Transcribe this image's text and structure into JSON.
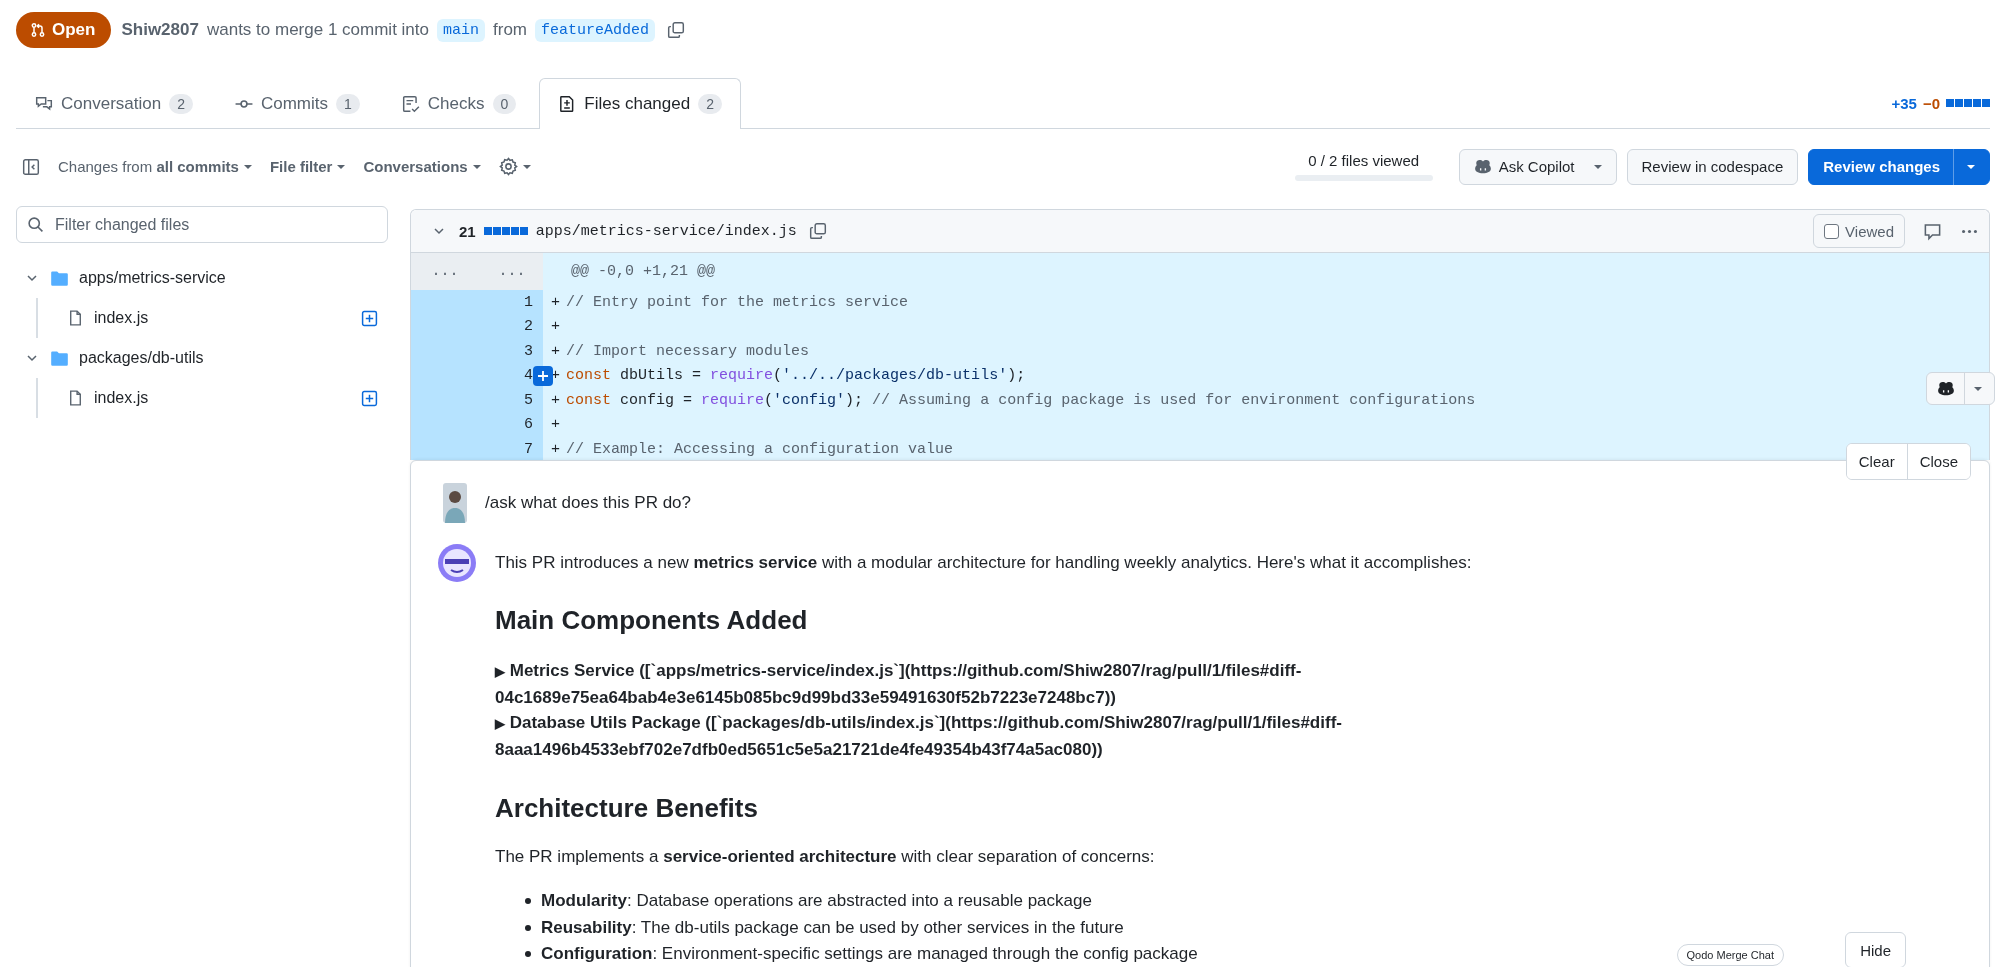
{
  "pr_header": {
    "state": "Open",
    "author": "Shiw2807",
    "text": "wants to merge 1 commit into",
    "base": "main",
    "from_word": "from",
    "head": "featureAdded"
  },
  "tabs": [
    {
      "label": "Conversation",
      "count": "2",
      "selected": false
    },
    {
      "label": "Commits",
      "count": "1",
      "selected": false
    },
    {
      "label": "Checks",
      "count": "0",
      "selected": false
    },
    {
      "label": "Files changed",
      "count": "2",
      "selected": true
    }
  ],
  "diffstat": {
    "additions": "+35",
    "deletions": "−0"
  },
  "toolbar": {
    "changes_from": "Changes from **all commits**",
    "file_filter": "File filter",
    "conversations": "Conversations",
    "files_viewed": {
      "text": "0 / 2 files viewed",
      "level": 0
    },
    "ask_copilot": "Ask Copilot",
    "codespace": "Review in codespace",
    "review": "Review changes"
  },
  "sidebar": {
    "filter_placeholder": "Filter changed files",
    "tree": [
      {
        "name": "apps/metrics-service",
        "expanded": true,
        "children": [
          {
            "name": "index.js"
          }
        ]
      },
      {
        "name": "packages/db-utils",
        "expanded": true,
        "children": [
          {
            "name": "index.js"
          }
        ]
      }
    ]
  },
  "file": {
    "count": "21",
    "path": "apps/metrics-service/index.js",
    "expanded": true,
    "viewed": false,
    "viewed_label": "Viewed",
    "old_marker": "...",
    "new_marker": "...",
    "hunk": "@@ -0,0 +1,21 @@",
    "lines": [
      {
        "number": "1",
        "sign": "+",
        "hovered": false,
        "tokens": [
          {
            "t": "// Entry point for the metrics service",
            "kind": "comment"
          }
        ]
      },
      {
        "number": "2",
        "sign": "+",
        "hovered": false
      },
      {
        "number": "3",
        "sign": "+",
        "hovered": false,
        "tokens": [
          {
            "t": "// Import necessary modules",
            "kind": "comment"
          }
        ]
      },
      {
        "number": "4",
        "sign": "+",
        "hovered": true,
        "tokens": [
          {
            "t": "const",
            "kind": "keyword"
          },
          {
            "t": " dbUtils = ",
            "kind": "plain"
          },
          {
            "t": "require",
            "kind": "function"
          },
          {
            "t": "(",
            "kind": "plain"
          },
          {
            "t": "'../../packages/db-utils'",
            "kind": "string"
          },
          {
            "t": ");",
            "kind": "plain"
          }
        ]
      },
      {
        "number": "5",
        "sign": "+",
        "hovered": false,
        "tokens": [
          {
            "t": "const",
            "kind": "keyword"
          },
          {
            "t": " config = ",
            "kind": "plain"
          },
          {
            "t": "require",
            "kind": "function"
          },
          {
            "t": "(",
            "kind": "plain"
          },
          {
            "t": "'config'",
            "kind": "string"
          },
          {
            "t": "); ",
            "kind": "plain"
          },
          {
            "t": "// Assuming a config package is used for environment configurations",
            "kind": "comment"
          }
        ]
      },
      {
        "number": "6",
        "sign": "+",
        "hovered": false
      },
      {
        "number": "7",
        "sign": "+",
        "hovered": false,
        "tokens": [
          {
            "t": "// Example: Accessing a configuration value",
            "kind": "comment"
          }
        ]
      }
    ]
  },
  "chat": {
    "clear": "Clear",
    "close": "Close",
    "tab_label": "Qodo Merge Chat",
    "hide": "Hide",
    "messages": [
      {
        "kind": "user",
        "text": "/ask what does this PR do?"
      },
      {
        "kind": "bot",
        "blocks": [
          {
            "kind": "paragraph",
            "text": "This PR introduces a new **metrics service** with a modular architecture for handling weekly analytics. Here's what it accomplishes:"
          },
          {
            "kind": "heading",
            "text": "Main Components Added"
          },
          {
            "kind": "details",
            "marker": "▶",
            "text": "Metrics Service ([`apps/metrics-service/index.js`](https://github.com/Shiw2807/rag/pull/1/files#diff-04c1689e75ea64bab4e3e6145b085bc9d99bd33e59491630f52b7223e7248bc7))"
          },
          {
            "kind": "details",
            "marker": "▶",
            "text": "Database Utils Package ([`packages/db-utils/index.js`](https://github.com/Shiw2807/rag/pull/1/files#diff-8aaa1496b4533ebf702e7dfb0ed5651c5e5a21721de4fe49354b43f74a5ac080))"
          },
          {
            "kind": "heading",
            "text": "Architecture Benefits"
          },
          {
            "kind": "paragraph",
            "text": "The PR implements a **service-oriented architecture** with clear separation of concerns:"
          },
          {
            "kind": "list",
            "items": [
              "**Modularity**: Database operations are abstracted into a reusable package",
              "**Reusability**: The db-utils package can be used by other services in the future",
              "**Configuration**: Environment-specific settings are managed through the config package"
            ]
          }
        ]
      }
    ]
  }
}
